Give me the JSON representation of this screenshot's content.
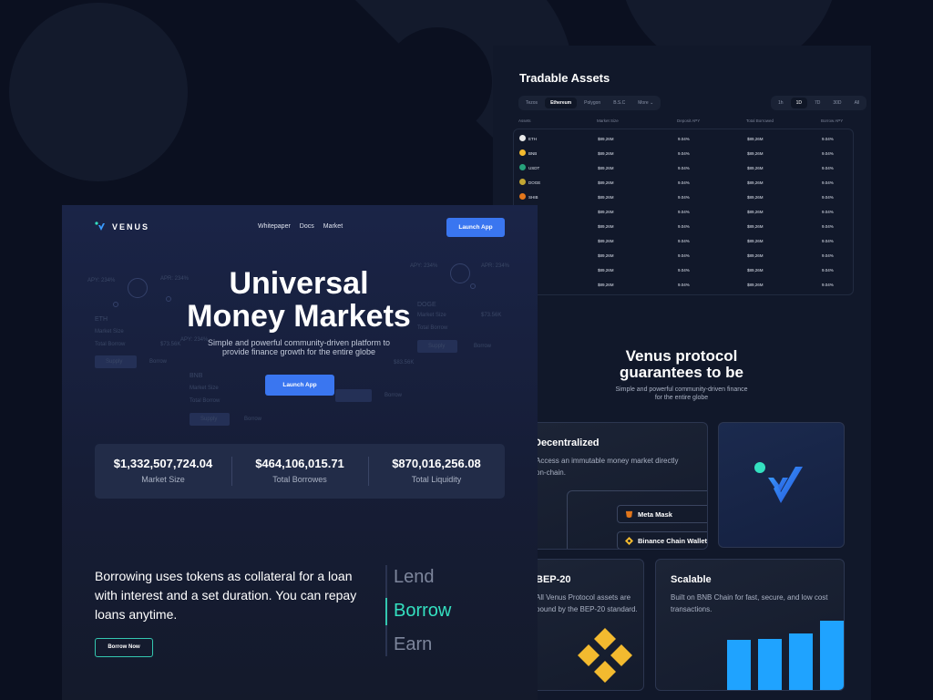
{
  "nav": {
    "brand": "VENUS",
    "links": [
      "Whitepaper",
      "Docs",
      "Market"
    ],
    "launch_label": "Launch App"
  },
  "hero": {
    "title_line1": "Universal",
    "title_line2": "Money Markets",
    "subtitle": "Simple and powerful community-driven platform to provide finance growth for the entire globe",
    "launch_label": "Launch App"
  },
  "bg_cards": {
    "eth": {
      "apy": "APY: 234%",
      "apr": "APR: 234%",
      "name": "ETH",
      "row1": "Market Size",
      "row2": "Total Borrow",
      "row3": "$73.56K",
      "btn1": "Supply",
      "btn2": "Borrow"
    },
    "doge": {
      "apy": "APY: 234%",
      "apr": "APR: 234%",
      "name": "DOGE",
      "row1": "Market Size",
      "row2": "Total Borrow",
      "row3": "$73.56K",
      "btn1": "Supply",
      "btn2": "Borrow"
    },
    "bnb": {
      "apy": "APY: 234%",
      "name": "BNB",
      "row1": "Market Size",
      "row2": "Total Borrow",
      "row3": "$83.56K",
      "btn1": "Supply",
      "btn2": "Borrow"
    }
  },
  "stats": [
    {
      "value": "$1,332,507,724.04",
      "label": "Market Size"
    },
    {
      "value": "$464,106,015.71",
      "label": "Total Borrowes"
    },
    {
      "value": "$870,016,256.08",
      "label": "Total Liquidity"
    }
  ],
  "borrow": {
    "text": "Borrowing uses tokens as collateral for a loan with interest and a set duration. You can repay loans anytime.",
    "button_label": "Borrow Now",
    "switch_items": [
      "Lend",
      "Borrow",
      "Earn"
    ],
    "active_item": "Borrow"
  },
  "tradable": {
    "title": "Tradable Assets",
    "chains": [
      "Tezos",
      "Ethereum",
      "Polygon",
      "B.S.C",
      "More"
    ],
    "active_chain": "Ethereum",
    "ranges": [
      "1h",
      "1D",
      "7D",
      "30D",
      "All"
    ],
    "active_range": "1D",
    "columns": [
      "Assets",
      "Market Size",
      "Deposit APY",
      "Total Borrowed",
      "Borrow APY"
    ],
    "rows": [
      {
        "asset": "ETH",
        "market_size": "$89,26M",
        "deposit_apy": "9.04%",
        "total_borrowed": "$89,26M",
        "borrow_apy": "9.04%",
        "color": "#e8e8e8"
      },
      {
        "asset": "BNB",
        "market_size": "$89,26M",
        "deposit_apy": "9.04%",
        "total_borrowed": "$89,26M",
        "borrow_apy": "9.04%",
        "color": "#f3ba2f"
      },
      {
        "asset": "USDT",
        "market_size": "$89,26M",
        "deposit_apy": "9.04%",
        "total_borrowed": "$89,26M",
        "borrow_apy": "9.04%",
        "color": "#26a17b"
      },
      {
        "asset": "DOGE",
        "market_size": "$89,26M",
        "deposit_apy": "9.04%",
        "total_borrowed": "$89,26M",
        "borrow_apy": "9.04%",
        "color": "#c2a633"
      },
      {
        "asset": "SHIB",
        "market_size": "$89,26M",
        "deposit_apy": "9.04%",
        "total_borrowed": "$89,26M",
        "borrow_apy": "9.04%",
        "color": "#e2761b"
      },
      {
        "asset": "",
        "market_size": "$89,26M",
        "deposit_apy": "9.04%",
        "total_borrowed": "$89,26M",
        "borrow_apy": "9.04%",
        "color": ""
      },
      {
        "asset": "",
        "market_size": "$89,26M",
        "deposit_apy": "9.04%",
        "total_borrowed": "$89,26M",
        "borrow_apy": "9.04%",
        "color": ""
      },
      {
        "asset": "",
        "market_size": "$89,26M",
        "deposit_apy": "9.04%",
        "total_borrowed": "$89,26M",
        "borrow_apy": "9.04%",
        "color": ""
      },
      {
        "asset": "",
        "market_size": "$89,26M",
        "deposit_apy": "9.04%",
        "total_borrowed": "$89,26M",
        "borrow_apy": "9.04%",
        "color": ""
      },
      {
        "asset": "",
        "market_size": "$89,26M",
        "deposit_apy": "9.04%",
        "total_borrowed": "$89,26M",
        "borrow_apy": "9.04%",
        "color": ""
      },
      {
        "asset": "",
        "market_size": "$89,26M",
        "deposit_apy": "9.04%",
        "total_borrowed": "$89,26M",
        "borrow_apy": "9.04%",
        "color": ""
      }
    ]
  },
  "protocol": {
    "title_line1": "Venus protocol",
    "title_line2": "guarantees to be",
    "subtitle": "Simple and powerful community-driven finance for the entire globe"
  },
  "features": {
    "decentralized": {
      "title": "Decentralized",
      "text": "Access an immutable money market directly on-chain.",
      "wallets": [
        "Meta Mask",
        "Binance Chain Wallet"
      ]
    },
    "bep20": {
      "title": "BEP-20",
      "text": "All Venus Protocol assets are bound by the BEP-20 standard."
    },
    "scalable": {
      "title": "Scalable",
      "text": "Built on BNB Chain for fast, secure, and low cost transactions."
    }
  },
  "colors": {
    "accent_blue": "#3a76f0",
    "accent_teal": "#34e0c0",
    "bar_blue": "#1fa3ff",
    "binance_yellow": "#f3ba2f"
  }
}
